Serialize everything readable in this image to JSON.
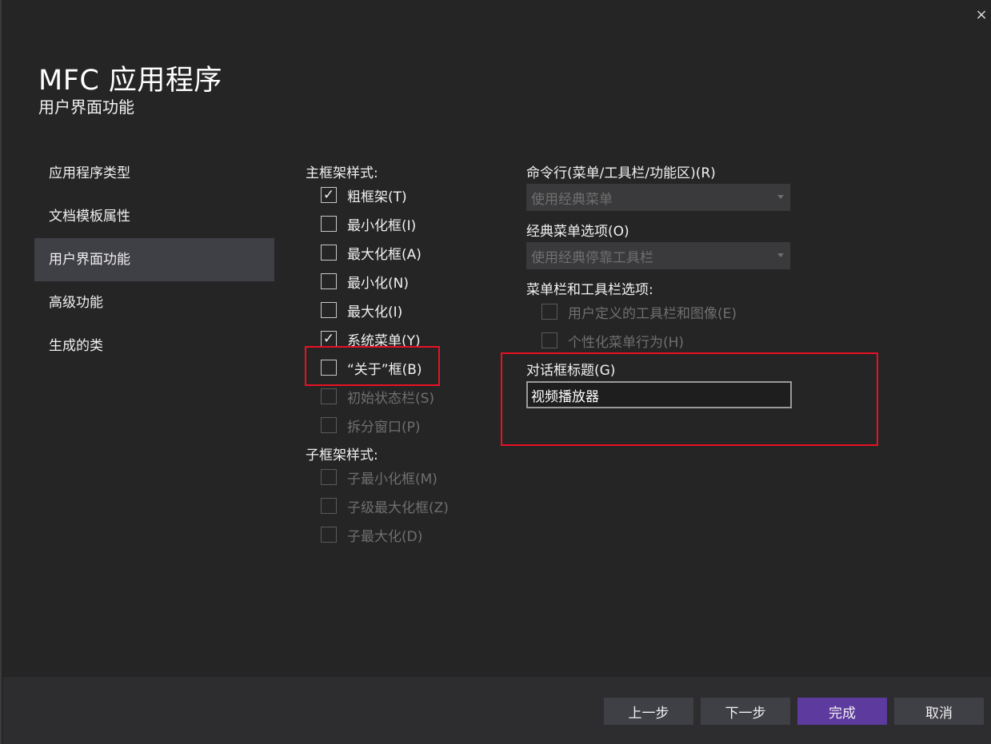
{
  "window": {
    "close_icon": "×"
  },
  "header": {
    "title": "MFC 应用程序",
    "subtitle": "用户界面功能"
  },
  "nav": {
    "items": [
      {
        "label": "应用程序类型",
        "selected": false
      },
      {
        "label": "文档模板属性",
        "selected": false
      },
      {
        "label": "用户界面功能",
        "selected": true
      },
      {
        "label": "高级功能",
        "selected": false
      },
      {
        "label": "生成的类",
        "selected": false
      }
    ]
  },
  "main_frame": {
    "label": "主框架样式:",
    "options": [
      {
        "label": "粗框架(T)",
        "checked": true,
        "enabled": true
      },
      {
        "label": "最小化框(I)",
        "checked": false,
        "enabled": true
      },
      {
        "label": "最大化框(A)",
        "checked": false,
        "enabled": true
      },
      {
        "label": "最小化(N)",
        "checked": false,
        "enabled": true
      },
      {
        "label": "最大化(I)",
        "checked": false,
        "enabled": true
      },
      {
        "label": "系统菜单(Y)",
        "checked": true,
        "enabled": true
      },
      {
        "label": "“关于”框(B)",
        "checked": false,
        "enabled": true
      },
      {
        "label": "初始状态栏(S)",
        "checked": false,
        "enabled": false
      },
      {
        "label": "拆分窗口(P)",
        "checked": false,
        "enabled": false
      }
    ]
  },
  "child_frame": {
    "label": "子框架样式:",
    "options": [
      {
        "label": "子最小化框(M)",
        "checked": false,
        "enabled": false
      },
      {
        "label": "子级最大化框(Z)",
        "checked": false,
        "enabled": false
      },
      {
        "label": "子最大化(D)",
        "checked": false,
        "enabled": false
      }
    ]
  },
  "command_bar": {
    "label": "命令行(菜单/工具栏/功能区)(R)",
    "value": "使用经典菜单"
  },
  "classic_menu": {
    "label": "经典菜单选项(O)",
    "value": "使用经典停靠工具栏"
  },
  "menubar_options": {
    "label": "菜单栏和工具栏选项:",
    "options": [
      {
        "label": "用户定义的工具栏和图像(E)",
        "checked": false,
        "enabled": false
      },
      {
        "label": "个性化菜单行为(H)",
        "checked": false,
        "enabled": false
      }
    ]
  },
  "dialog_title": {
    "label": "对话框标题(G)",
    "value": "视频播放器"
  },
  "footer": {
    "prev": "上一步",
    "next": "下一步",
    "finish": "完成",
    "cancel": "取消"
  },
  "colors": {
    "background": "#252526",
    "selected_nav": "#3f3f46",
    "primary_button": "#5c3a9e",
    "highlight_border": "#e81123"
  },
  "icons": {
    "check": "check-icon",
    "dropdown": "chevron-down-icon",
    "close": "close-icon"
  }
}
